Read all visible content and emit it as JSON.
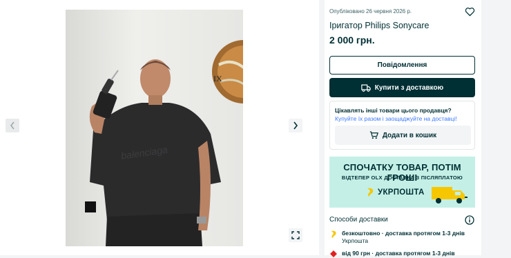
{
  "listing": {
    "published": "Опубліковано 26 червня 2026 р.",
    "title": "Іригатор Philips Sonycare",
    "price": "2 000 грн."
  },
  "actions": {
    "message_label": "Повідомлення",
    "buy_label": "Купити з доставкою"
  },
  "seller_promo": {
    "question": "Цікавлять інші товари цього продавця?",
    "link": "Купуйте їх разом і заощаджуйте на доставці!",
    "cart_label": "Додати в кошик"
  },
  "banner": {
    "headline": "СПОЧАТКУ ТОВАР, ПОТІМ ГРОШІ",
    "subline": "ВІДТЕПЕР OLX ДОСТАВКА З ПІСЛЯПЛАТОЮ",
    "brand": "УКРПОШТА"
  },
  "delivery": {
    "section_title": "Способи доставки",
    "options": [
      {
        "title": "безкоштовно · доставка протягом 1-3 днів",
        "carrier": "Укрпошта"
      },
      {
        "title": "від 90 грн · доставка протягом 1-3 днів",
        "carrier": ""
      }
    ]
  },
  "icons": {
    "prev": "chevron-left-icon",
    "next": "chevron-right-icon",
    "expand": "expand-icon",
    "favorite": "heart-icon",
    "truck": "truck-icon",
    "cart": "cart-icon",
    "info": "info-icon"
  },
  "colors": {
    "primary": "#002f34",
    "link": "#3a77ff",
    "banner_bg": "#c4efe6",
    "ukrposhta_yellow": "#f6c700"
  }
}
